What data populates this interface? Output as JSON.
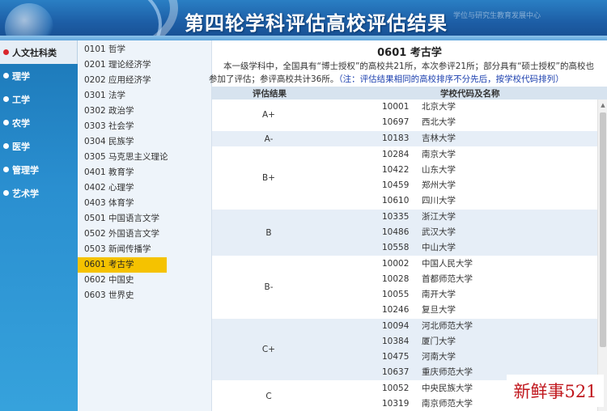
{
  "header": {
    "title": "第四轮学科评估高校评估结果",
    "faint_text": "学位与研究生教育发展中心"
  },
  "categories": [
    {
      "label": "人文社科类",
      "active": true
    },
    {
      "label": "理学",
      "active": false
    },
    {
      "label": "工学",
      "active": false
    },
    {
      "label": "农学",
      "active": false
    },
    {
      "label": "医学",
      "active": false
    },
    {
      "label": "管理学",
      "active": false
    },
    {
      "label": "艺术学",
      "active": false
    }
  ],
  "subjects": [
    {
      "label": "0101 哲学",
      "active": false
    },
    {
      "label": "0201 理论经济学",
      "active": false
    },
    {
      "label": "0202 应用经济学",
      "active": false
    },
    {
      "label": "0301 法学",
      "active": false
    },
    {
      "label": "0302 政治学",
      "active": false
    },
    {
      "label": "0303 社会学",
      "active": false
    },
    {
      "label": "0304 民族学",
      "active": false
    },
    {
      "label": "0305 马克思主义理论",
      "active": false
    },
    {
      "label": "0401 教育学",
      "active": false
    },
    {
      "label": "0402 心理学",
      "active": false
    },
    {
      "label": "0403 体育学",
      "active": false
    },
    {
      "label": "0501 中国语言文学",
      "active": false
    },
    {
      "label": "0502 外国语言文学",
      "active": false
    },
    {
      "label": "0503 新闻传播学",
      "active": false
    },
    {
      "label": "0601 考古学",
      "active": true
    },
    {
      "label": "0602 中国史",
      "active": false
    },
    {
      "label": "0603 世界史",
      "active": false
    }
  ],
  "main": {
    "title": "0601 考古学",
    "intro_line1": "本一级学科中，全国具有“博士授权”的高校共21所，本次参评21所；部分具有“硕士授权”的高校也",
    "intro_line2": "参加了评估；参评高校共计36所。",
    "intro_note": "（注：评估结果相同的高校排序不分先后，按学校代码排列）",
    "col_grade": "评估结果",
    "col_school": "学校代码及名称"
  },
  "results": [
    {
      "grade": "A+",
      "shade": false,
      "schools": [
        {
          "code": "10001",
          "name": "北京大学"
        },
        {
          "code": "10697",
          "name": "西北大学"
        }
      ]
    },
    {
      "grade": "A-",
      "shade": true,
      "schools": [
        {
          "code": "10183",
          "name": "吉林大学"
        }
      ]
    },
    {
      "grade": "B+",
      "shade": false,
      "schools": [
        {
          "code": "10284",
          "name": "南京大学"
        },
        {
          "code": "10422",
          "name": "山东大学"
        },
        {
          "code": "10459",
          "name": "郑州大学"
        },
        {
          "code": "10610",
          "name": "四川大学"
        }
      ]
    },
    {
      "grade": "B",
      "shade": true,
      "schools": [
        {
          "code": "10335",
          "name": "浙江大学"
        },
        {
          "code": "10486",
          "name": "武汉大学"
        },
        {
          "code": "10558",
          "name": "中山大学"
        }
      ]
    },
    {
      "grade": "B-",
      "shade": false,
      "schools": [
        {
          "code": "10002",
          "name": "中国人民大学"
        },
        {
          "code": "10028",
          "name": "首都师范大学"
        },
        {
          "code": "10055",
          "name": "南开大学"
        },
        {
          "code": "10246",
          "name": "复旦大学"
        }
      ]
    },
    {
      "grade": "C+",
      "shade": true,
      "schools": [
        {
          "code": "10094",
          "name": "河北师范大学"
        },
        {
          "code": "10384",
          "name": "厦门大学"
        },
        {
          "code": "10475",
          "name": "河南大学"
        },
        {
          "code": "10637",
          "name": "重庆师范大学"
        }
      ]
    },
    {
      "grade": "C",
      "shade": false,
      "schools": [
        {
          "code": "10052",
          "name": "中央民族大学"
        },
        {
          "code": "10319",
          "name": "南京师范大学"
        }
      ]
    }
  ],
  "watermark": "新鲜事521",
  "colors": {
    "banner": "#1d5ea6",
    "active_subject": "#f5c200",
    "note": "#1b3fae",
    "watermark": "#c0161c"
  }
}
